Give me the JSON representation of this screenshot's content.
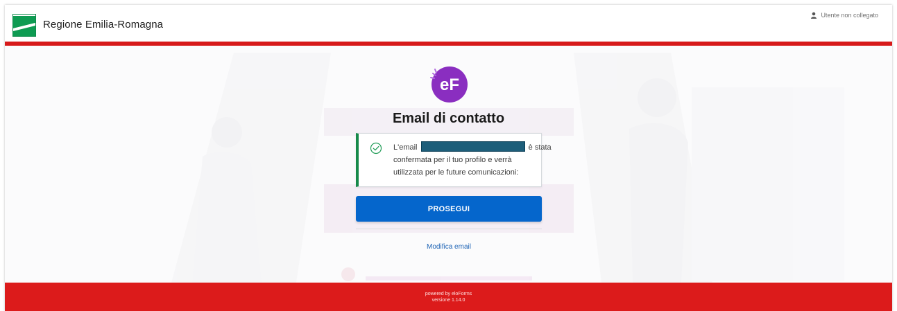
{
  "header": {
    "brand": "Regione Emilia-Romagna",
    "user_status": "Utente non collegato"
  },
  "app_logo_text": "eF",
  "main": {
    "title": "Email di contatto",
    "alert": {
      "line1_prefix": "L'email",
      "line1_suffix": "è stata",
      "line2": "confermata per il tuo profilo e verrà",
      "line3": "utilizzata per le future comunicazioni:"
    },
    "primary_button": "PROSEGUI",
    "secondary_link": "Modifica email"
  },
  "footer": {
    "powered": "powered by eloForms",
    "version": "versione 1.14.0"
  },
  "colors": {
    "brand_red": "#d71a1a",
    "footer_red": "#dc1b1b",
    "primary_blue": "#0566cc",
    "success_green": "#168a4a",
    "logo_purple": "#8a2ec0"
  }
}
